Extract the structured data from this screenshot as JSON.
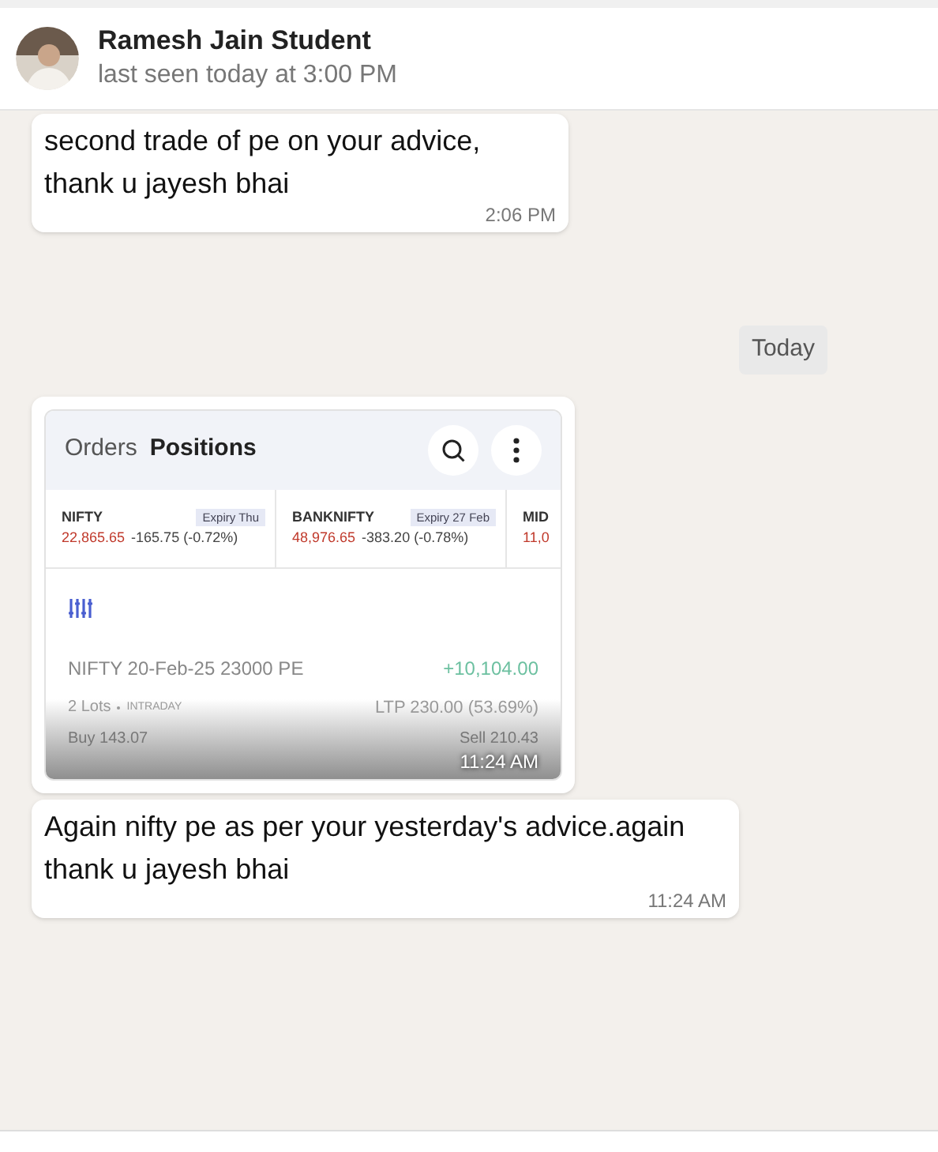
{
  "header": {
    "name": "Ramesh Jain Student",
    "status": "last seen today at 3:00 PM"
  },
  "messages": [
    {
      "kind": "text",
      "text": "second trade of pe on your advice, thank u jayesh bhai",
      "time": "2:06 PM"
    },
    {
      "kind": "date",
      "text": "Today"
    },
    {
      "kind": "screenshot",
      "time": "11:24 AM",
      "app": {
        "tabs": [
          {
            "label": "Orders",
            "selected": false
          },
          {
            "label": "Positions",
            "selected": true
          }
        ],
        "indices": [
          {
            "name": "NIFTY",
            "expiry": "Expiry Thu",
            "price": "22,865.65",
            "change": "-165.75 (-0.72%)"
          },
          {
            "name": "BANKNIFTY",
            "expiry": "Expiry 27 Feb",
            "price": "48,976.65",
            "change": "-383.20 (-0.78%)"
          },
          {
            "name": "MID",
            "price": "11,0"
          }
        ],
        "position": {
          "symbol": "NIFTY 20-Feb-25 23000 PE",
          "pnl": "+10,104.00",
          "lots": "2 Lots",
          "product": "INTRADAY",
          "ltp": "LTP 230.00 (53.69%)",
          "buy": "Buy 143.07",
          "sell": "Sell 210.43"
        }
      }
    },
    {
      "kind": "text",
      "text": "Again nifty pe as per your yesterday's advice.again thank u jayesh bhai",
      "time": "11:24 AM"
    }
  ]
}
